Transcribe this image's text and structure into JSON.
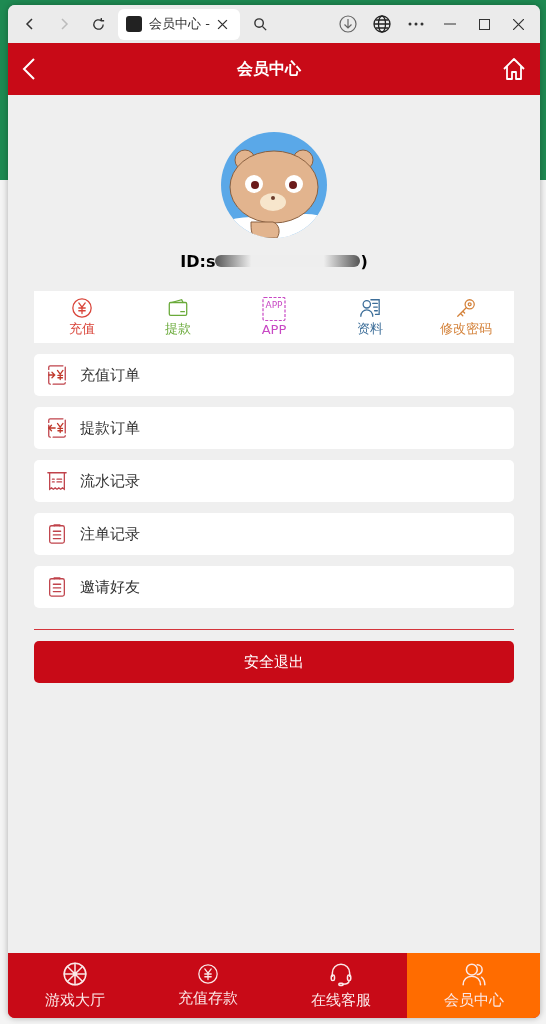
{
  "browser": {
    "tab_title": "会员中心 -"
  },
  "header": {
    "title": "会员中心"
  },
  "profile": {
    "id_prefix": "ID:s",
    "id_suffix": ")"
  },
  "shortcuts": [
    {
      "label": "充值",
      "kind": "yen",
      "color": "#d9453a"
    },
    {
      "label": "提款",
      "kind": "wallet",
      "color": "#6aaa3a"
    },
    {
      "label": "APP",
      "kind": "app",
      "icon_text": "APP",
      "color": "#c848c4"
    },
    {
      "label": "资料",
      "kind": "profile",
      "color": "#3d6e99"
    },
    {
      "label": "修改密码",
      "kind": "key",
      "color": "#d4823a"
    }
  ],
  "menu": [
    {
      "label": "充值订单",
      "kind": "deposit"
    },
    {
      "label": "提款订单",
      "kind": "withdraw"
    },
    {
      "label": "流水记录",
      "kind": "receipt"
    },
    {
      "label": "注单记录",
      "kind": "list"
    },
    {
      "label": "邀请好友",
      "kind": "list"
    }
  ],
  "logout": {
    "label": "安全退出"
  },
  "nav": [
    {
      "label": "游戏大厅",
      "kind": "wheel",
      "selected": false
    },
    {
      "label": "充值存款",
      "kind": "yen",
      "selected": false
    },
    {
      "label": "在线客服",
      "kind": "headset",
      "selected": false
    },
    {
      "label": "会员中心",
      "kind": "users",
      "selected": true
    }
  ]
}
